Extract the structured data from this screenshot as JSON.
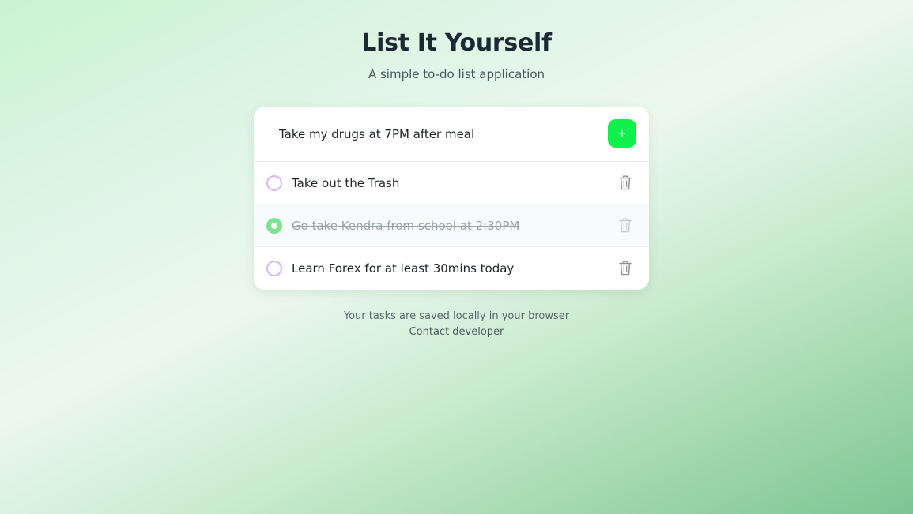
{
  "header": {
    "title": "List It Yourself",
    "subtitle": "A simple to-do list application"
  },
  "new_task": {
    "value": "Take my drugs at 7PM after meal",
    "placeholder": "",
    "add_label": "+"
  },
  "tasks": [
    {
      "label": "Take out the Trash",
      "completed": false
    },
    {
      "label": "Go take Kendra from school at 2:30PM",
      "completed": true
    },
    {
      "label": "Learn Forex for at least 30mins today",
      "completed": false
    }
  ],
  "icons": {
    "checkbox": "circle-checkbox-icon",
    "delete": "trash-icon"
  },
  "colors": {
    "accent": "#0ff04d",
    "checked": "#7ae590",
    "unchecked_border": "#d7b5f0",
    "title": "#1c2833"
  },
  "footer": {
    "note": "Your tasks are saved locally in your browser",
    "contact_link": "Contact developer"
  }
}
